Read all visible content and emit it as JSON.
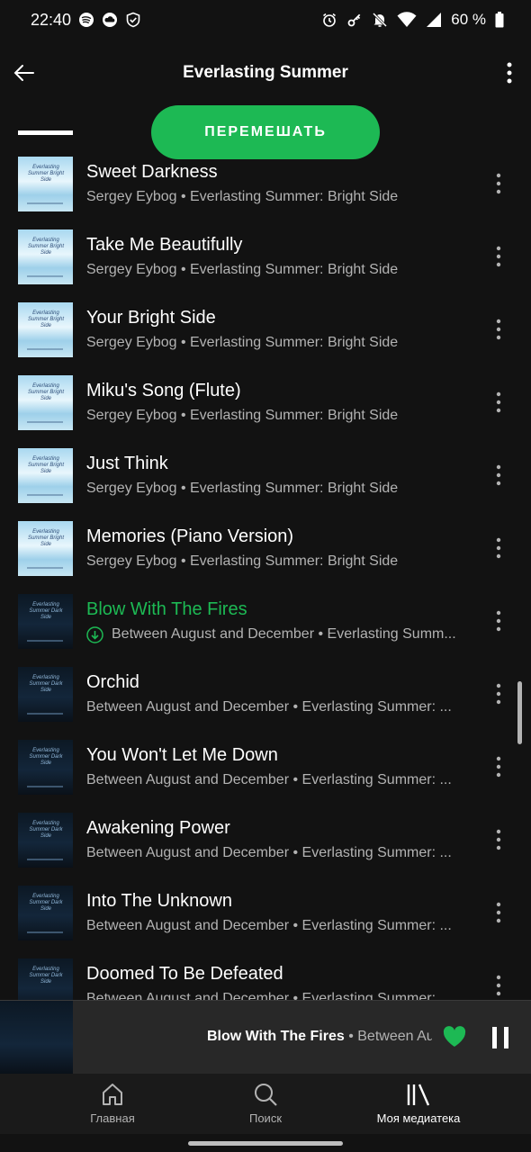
{
  "status_bar": {
    "time": "22:40",
    "battery": "60 %",
    "icons_left": [
      "spotify-icon",
      "cloud-icon",
      "shield-icon"
    ],
    "icons_right": [
      "alarm-icon",
      "key-icon",
      "mute-icon",
      "wifi-icon",
      "signal-icon",
      "battery-icon"
    ]
  },
  "header": {
    "title": "Everlasting Summer"
  },
  "shuffle_label": "ПЕРЕМЕШАТЬ",
  "tracks": [
    {
      "title": "Sweet Darkness",
      "subtitle": "Sergey Eybog • Everlasting Summer: Bright Side"
    },
    {
      "title": "Take Me Beautifully",
      "subtitle": "Sergey Eybog • Everlasting Summer: Bright Side"
    },
    {
      "title": "Your Bright Side",
      "subtitle": "Sergey Eybog • Everlasting Summer: Bright Side"
    },
    {
      "title": "Miku's Song (Flute)",
      "subtitle": "Sergey Eybog • Everlasting Summer: Bright Side"
    },
    {
      "title": "Just Think",
      "subtitle": "Sergey Eybog • Everlasting Summer: Bright Side"
    },
    {
      "title": "Memories (Piano Version)",
      "subtitle": "Sergey Eybog • Everlasting Summer: Bright Side"
    },
    {
      "title": "Blow With The Fires",
      "subtitle": "Between August and December • Everlasting Summ..."
    },
    {
      "title": "Orchid",
      "subtitle": "Between August and December • Everlasting Summer: ..."
    },
    {
      "title": "You Won't Let Me Down",
      "subtitle": "Between August and December • Everlasting Summer: ..."
    },
    {
      "title": "Awakening Power",
      "subtitle": "Between August and December • Everlasting Summer: ..."
    },
    {
      "title": "Into The Unknown",
      "subtitle": "Between August and December • Everlasting Summer: ..."
    },
    {
      "title": "Doomed To Be Defeated",
      "subtitle": "Between August and December • Everlasting Summer: ..."
    }
  ],
  "cover_texts": {
    "bright": "Everlasting Summer Bright Side",
    "dark": "Everlasting Summer Dark Side"
  },
  "mini_player": {
    "title": "Blow With The Fires",
    "separator": " • ",
    "artist": "Between August and December"
  },
  "nav": {
    "home": "Главная",
    "search": "Поиск",
    "library": "Моя медиатека"
  },
  "colors": {
    "accent": "#1db954",
    "background": "#121212",
    "secondary_text": "#b3b3b3"
  }
}
